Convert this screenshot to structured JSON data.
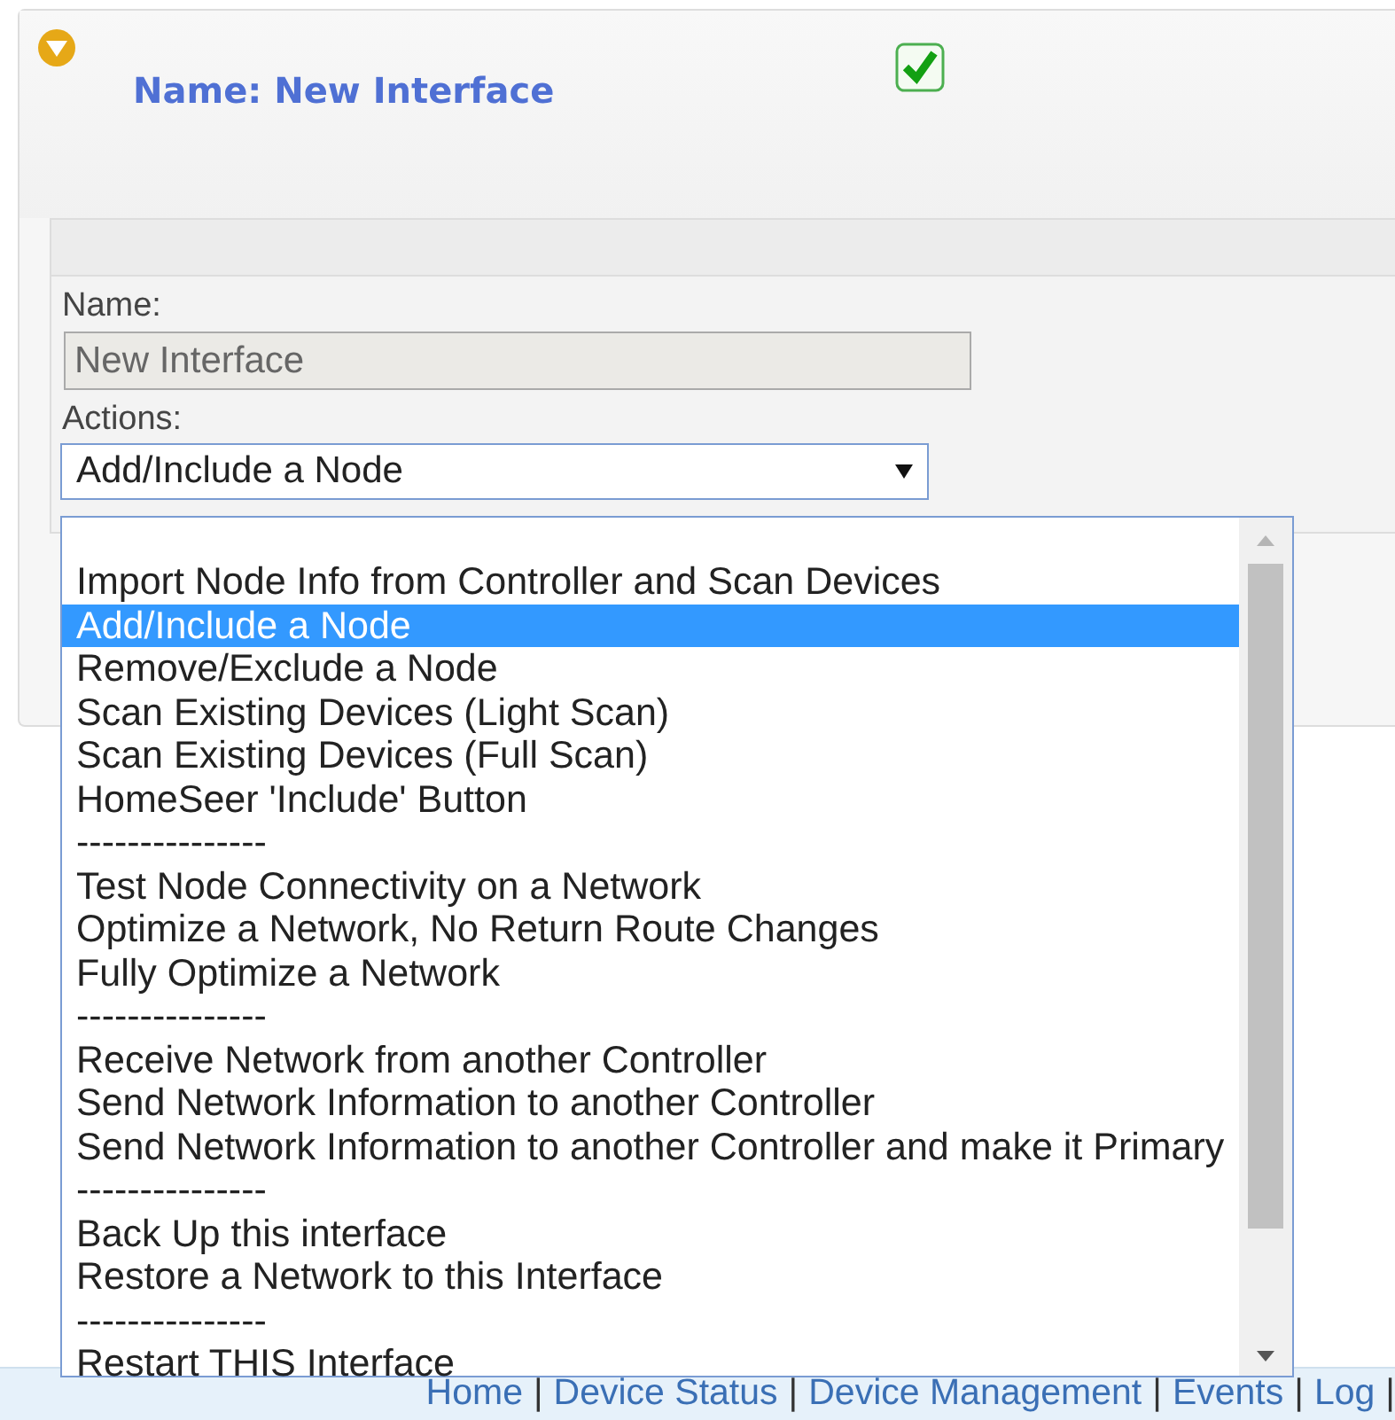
{
  "panel": {
    "title": "Name: New Interface",
    "enabled": true
  },
  "form": {
    "name_label": "Name:",
    "name_value": "New Interface",
    "actions_label": "Actions:",
    "actions_value": "Add/Include a Node"
  },
  "dropdown": {
    "options": [
      {
        "label": "Import Node Info from Controller and Scan Devices",
        "selected": false
      },
      {
        "label": "Add/Include a Node",
        "selected": true
      },
      {
        "label": "Remove/Exclude a Node",
        "selected": false
      },
      {
        "label": "Scan Existing Devices (Light Scan)",
        "selected": false
      },
      {
        "label": "Scan Existing Devices (Full Scan)",
        "selected": false
      },
      {
        "label": "HomeSeer 'Include' Button",
        "selected": false
      },
      {
        "label": "---------------",
        "selected": false
      },
      {
        "label": "Test Node Connectivity on a Network",
        "selected": false
      },
      {
        "label": "Optimize a Network, No Return Route Changes",
        "selected": false
      },
      {
        "label": "Fully Optimize a Network",
        "selected": false
      },
      {
        "label": "---------------",
        "selected": false
      },
      {
        "label": "Receive Network from another Controller",
        "selected": false
      },
      {
        "label": "Send Network Information to another Controller",
        "selected": false
      },
      {
        "label": "Send Network Information to another Controller and make it Primary",
        "selected": false
      },
      {
        "label": "---------------",
        "selected": false
      },
      {
        "label": "Back Up this interface",
        "selected": false
      },
      {
        "label": "Restore a Network to this Interface",
        "selected": false
      },
      {
        "label": "---------------",
        "selected": false
      },
      {
        "label": "Restart THIS Interface",
        "selected": false
      }
    ]
  },
  "footer": {
    "links": [
      "Home",
      "Device Status",
      "Device Management",
      "Events",
      "Log"
    ],
    "separator": "|"
  }
}
